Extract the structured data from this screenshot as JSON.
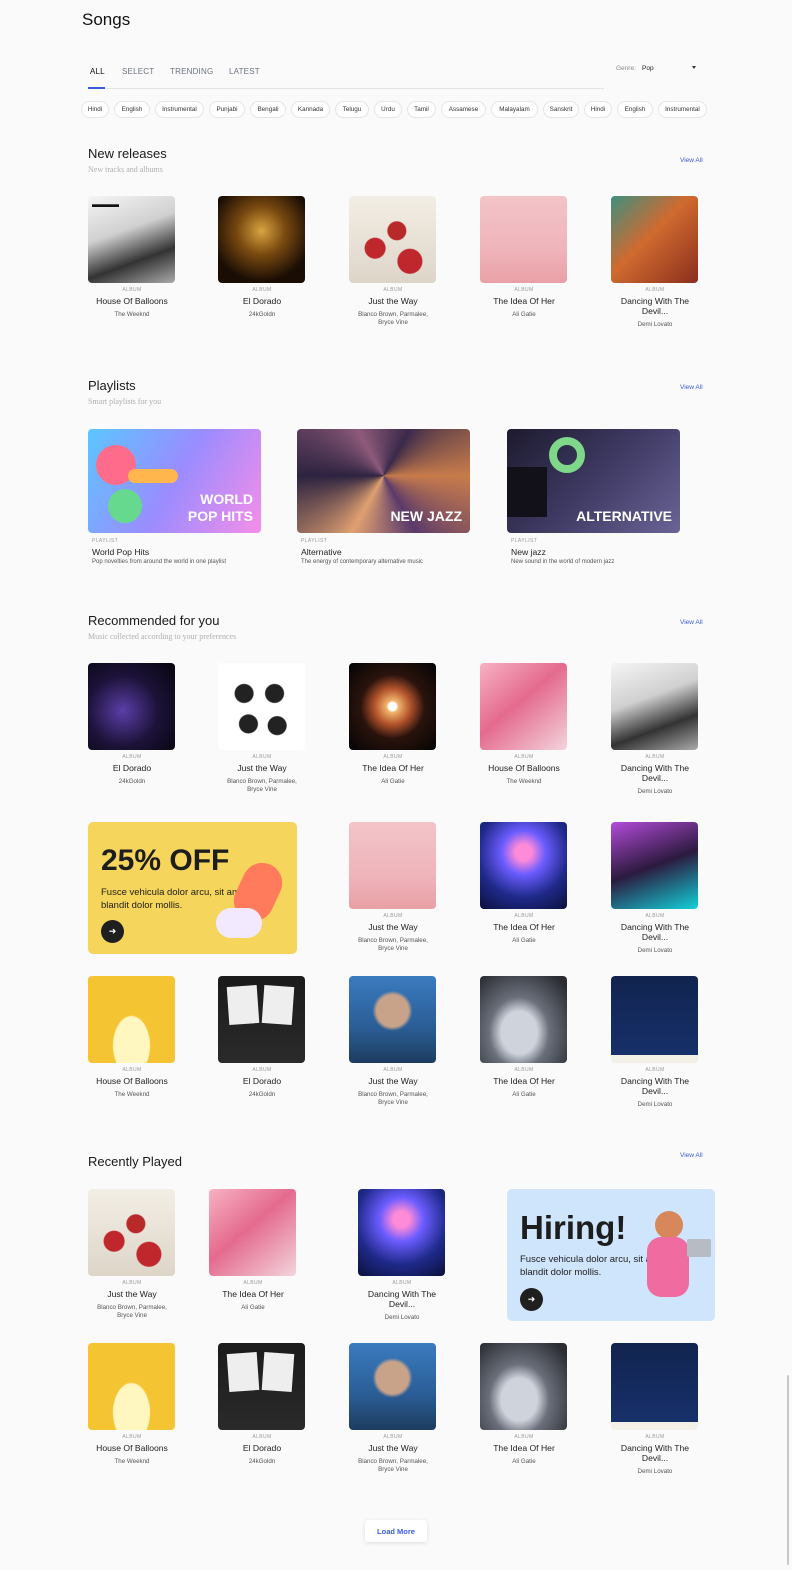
{
  "page": {
    "title": "Songs"
  },
  "tabs": [
    "ALL",
    "SELECT",
    "TRENDING",
    "LATEST"
  ],
  "genre": {
    "label": "Genre:",
    "value": "Pop"
  },
  "chips": [
    "Hindi",
    "English",
    "Instrumental",
    "Punjabi",
    "Bengali",
    "Kannada",
    "Telugu",
    "Urdu",
    "Tamil",
    "Assamese",
    "Malayalam",
    "Sanskrit",
    "Hindi",
    "English",
    "Instrumental"
  ],
  "new_releases": {
    "title": "New releases",
    "subtitle": "New tracks and albums",
    "view_all": "View All",
    "items": [
      {
        "kind": "ALBUM",
        "title": "House Of Balloons",
        "artist": "The Weeknd"
      },
      {
        "kind": "ALBUM",
        "title": "El Dorado",
        "artist": "24kGoldn"
      },
      {
        "kind": "ALBUM",
        "title": "Just the Way",
        "artist": "Blanco Brown, Parmalee, Bryce Vine"
      },
      {
        "kind": "ALBUM",
        "title": "The Idea Of Her",
        "artist": "Ali Gatie"
      },
      {
        "kind": "ALBUM",
        "title": "Dancing With The Devil...",
        "artist": "Demi Lovato"
      }
    ]
  },
  "playlists": {
    "title": "Playlists",
    "subtitle": "Smart playlists for you",
    "view_all": "View All",
    "items": [
      {
        "cover_text": "WORLD\nPOP HITS",
        "kind": "PLAYLIST",
        "title": "World Pop Hits",
        "desc": "Pop novelties from around the world in one playlist"
      },
      {
        "cover_text": "NEW JAZZ",
        "kind": "PLAYLIST",
        "title": "Alternative",
        "desc": "The energy of contemporary alternative music"
      },
      {
        "cover_text": "ALTERNATIVE",
        "kind": "PLAYLIST",
        "title": "New jazz",
        "desc": "New sound in the world of modern jazz"
      }
    ]
  },
  "recommended": {
    "title": "Recommended for you",
    "subtitle": "Music collected according to your preferences",
    "view_all": "View All",
    "row1": [
      {
        "kind": "ALBUM",
        "title": "El Dorado",
        "artist": "24kGoldn"
      },
      {
        "kind": "ALBUM",
        "title": "Just the Way",
        "artist": "Blanco Brown, Parmalee, Bryce Vine"
      },
      {
        "kind": "ALBUM",
        "title": "The Idea Of Her",
        "artist": "Ali Gatie"
      },
      {
        "kind": "ALBUM",
        "title": "House Of Balloons",
        "artist": "The Weeknd"
      },
      {
        "kind": "ALBUM",
        "title": "Dancing With The Devil...",
        "artist": "Demi Lovato"
      }
    ],
    "row2": [
      {
        "kind": "ALBUM",
        "title": "Just the Way",
        "artist": "Blanco Brown, Parmalee, Bryce Vine"
      },
      {
        "kind": "ALBUM",
        "title": "The Idea Of Her",
        "artist": "Ali Gatie"
      },
      {
        "kind": "ALBUM",
        "title": "Dancing With The Devil...",
        "artist": "Demi Lovato"
      }
    ],
    "row3": [
      {
        "kind": "ALBUM",
        "title": "House Of Balloons",
        "artist": "The Weeknd"
      },
      {
        "kind": "ALBUM",
        "title": "El Dorado",
        "artist": "24kGoldn"
      },
      {
        "kind": "ALBUM",
        "title": "Just the Way",
        "artist": "Blanco Brown, Parmalee, Bryce Vine"
      },
      {
        "kind": "ALBUM",
        "title": "The Idea Of Her",
        "artist": "Ali Gatie"
      },
      {
        "kind": "ALBUM",
        "title": "Dancing With The Devil...",
        "artist": "Demi Lovato"
      }
    ]
  },
  "promo_sale": {
    "headline": "25% OFF",
    "body": "Fusce vehicula dolor arcu, sit amet blandit dolor mollis."
  },
  "recently_played": {
    "title": "Recently Played",
    "view_all": "View All",
    "row1": [
      {
        "kind": "ALBUM",
        "title": "Just the Way",
        "artist": "Blanco Brown, Parmalee, Bryce Vine"
      },
      {
        "kind": "ALBUM",
        "title": "The Idea Of Her",
        "artist": "Ali Gatie"
      },
      {
        "kind": "ALBUM",
        "title": "Dancing With The Devil...",
        "artist": "Demi Lovato"
      }
    ],
    "row2": [
      {
        "kind": "ALBUM",
        "title": "House Of Balloons",
        "artist": "The Weeknd"
      },
      {
        "kind": "ALBUM",
        "title": "El Dorado",
        "artist": "24kGoldn"
      },
      {
        "kind": "ALBUM",
        "title": "Just the Way",
        "artist": "Blanco Brown, Parmalee, Bryce Vine"
      },
      {
        "kind": "ALBUM",
        "title": "The Idea Of Her",
        "artist": "Ali Gatie"
      },
      {
        "kind": "ALBUM",
        "title": "Dancing With The Devil...",
        "artist": "Demi Lovato"
      }
    ]
  },
  "promo_hiring": {
    "headline": "Hiring!",
    "body": "Fusce vehicula dolor arcu, sit amet blandit dolor mollis."
  },
  "load_more": "Load More",
  "colors": {
    "accent": "#3b5bdb",
    "sale_bg": "#f6d55c",
    "hiring_bg": "#cfe5fb"
  }
}
